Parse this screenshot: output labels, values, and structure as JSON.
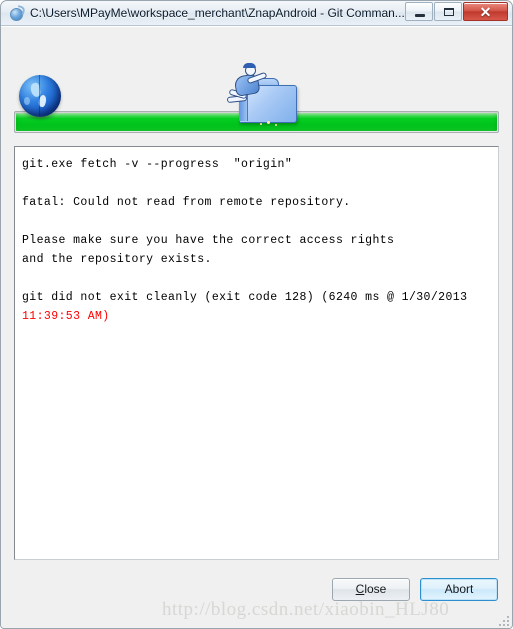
{
  "window": {
    "title": "C:\\Users\\MPayMe\\workspace_merchant\\ZnapAndroid - Git Comman...",
    "icon": "git-app-icon",
    "controls": {
      "minimize_label": "–",
      "maximize_label": "□",
      "close_label": "✕"
    }
  },
  "banner": {
    "globe_icon": "blue-globe-icon",
    "folder_icon": "person-pushing-folder-icon"
  },
  "progress": {
    "value": 100,
    "max": 100,
    "fill_color": "#00c41c"
  },
  "console": {
    "command_line": "git.exe fetch -v --progress  \"origin\"",
    "error_line": "fatal: Could not read from remote repository.",
    "hint_line_1": "Please make sure you have the correct access rights",
    "hint_line_2": "and the repository exists.",
    "exit_line": "git did not exit cleanly (exit code 128) (6240 ms @ 1/30/2013",
    "exit_timestamp": "11:39:53 AM)",
    "timestamp_color": "#ff0000"
  },
  "buttons": {
    "close": {
      "accel": "C",
      "rest": "lose"
    },
    "abort": {
      "label": "Abort",
      "is_default": true
    }
  },
  "watermark": {
    "text": "http://blog.csdn.net/xiaobin_HLJ80"
  }
}
